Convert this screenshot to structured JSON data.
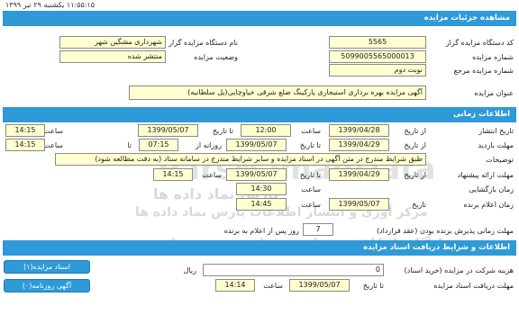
{
  "datetime": "۱۱:۵۵:۱۵  یکشنبه ۲۹ تیر ۱۳۹۹",
  "details": {
    "header": "مشاهده جزئیات مزایده",
    "org_code_label": "کد دستگاه مزایده گزار",
    "org_code": "5565",
    "org_name_label": "نام دستگاه مزایده گزار",
    "org_name": "شهرداری مشگین شهر",
    "auction_no_label": "شماره مزایده",
    "auction_no": "5099005565000013",
    "status_label": "وضعیت مزایده",
    "status": "منتشر شده",
    "ref_no_label": "شماره مزایده مرجع",
    "ref_no": "نوبت دوم",
    "title_label": "عنوان مزایده",
    "title": "آگهی مزایده بهره برداری استیجاری پارکینگ ضلع شرقی خیاوچایی(پل سلطانیه)"
  },
  "timing": {
    "header": "اطلاعات زمانی",
    "publish_label": "تاریخ انتشار",
    "visit_label": "مهلت بازدید",
    "desc_label": "توضیحات",
    "submit_label": "مهلت ارائه پیشنهاد",
    "opening_label": "زمان بازگشایی",
    "winner_label": "زمان اعلام برنده",
    "from_date": "از تاریخ",
    "to_date": "تا تاریخ",
    "hour": "ساعت",
    "daily": "روزانه از",
    "to": "تا",
    "date": "تاریخ",
    "publish_from": "1399/04/28",
    "publish_from_time": "12:00",
    "publish_to": "1399/05/07",
    "publish_to_time": "14:15",
    "visit_from": "1399/04/29",
    "visit_daily_from": "07:15",
    "visit_to": "1399/05/07",
    "visit_to_time": "14:15",
    "description": "طبق شرایط مندرج در متن آگهی در اسناد مزایده و سایر شرایط مندرج در سامانه ستاد (به دقت مطالعه شود)",
    "submit_from": "1399/04/29",
    "submit_to": "1399/05/07",
    "submit_to_time": "14:15",
    "opening_time": "14:30",
    "winner_date": "1399/05/07",
    "winner_time": "14:45",
    "acceptance_label": "مهلت زمانی پذیرش برنده بودن (عقد قرارداد)",
    "acceptance_days": "7",
    "acceptance_suffix": "روز پس از اعلام به برنده"
  },
  "docs": {
    "header": "اطلاعات و شرایط دریافت اسناد مزایده",
    "fee_label": "هزینه شرکت در مزایده (خرید اسناد)",
    "fee": "0",
    "currency": "ریال",
    "deadline_label": "مهلت دریافت اسناد مزایده",
    "deadline_date": "1399/05/07",
    "deadline_time": "14:14",
    "button_docs": "اسناد مزایده(۱)",
    "button_ads": "آگهی روزنامه(۰)"
  },
  "watermark": {
    "brand": "ParsNamadData",
    "line1": "پارس نماد داده ها",
    "line2": "مرکز آوری و انتشار اطلاعات پارس نماد داده ها",
    "line3": "پایگاه اطلاع رسانی مناقصه و مزایده"
  }
}
